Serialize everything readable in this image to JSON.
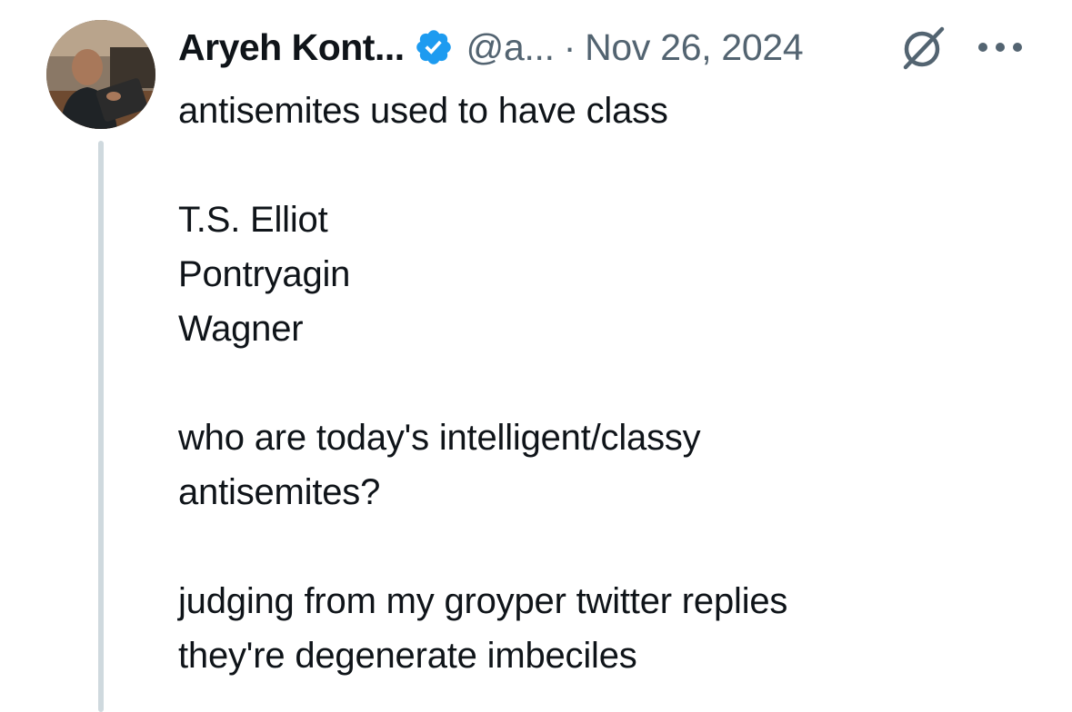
{
  "tweet": {
    "author_name": "Aryeh Kont...",
    "handle": "@a...",
    "separator": "·",
    "date": "Nov 26, 2024",
    "icons": {
      "verified": "verified-badge-icon",
      "grok": "grok-icon",
      "more": "more-options-icon"
    },
    "colors": {
      "verified": "#1d9bf0",
      "muted": "#536471",
      "text": "#0f1419",
      "thread_line": "#cfd9de"
    },
    "body_lines": [
      "antisemites used to have class",
      "",
      "T.S. Elliot",
      "Pontryagin",
      "Wagner",
      "",
      "who are today's intelligent/classy",
      "antisemites?",
      "",
      "judging from my groyper twitter replies",
      "they're degenerate imbeciles"
    ]
  }
}
